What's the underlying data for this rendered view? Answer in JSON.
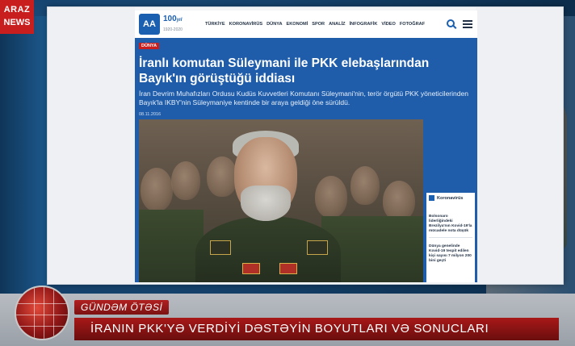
{
  "channel": {
    "line1": "ARAZ",
    "line2": "NEWS"
  },
  "site": {
    "logo_text": "AA",
    "anniversary": "100",
    "anniversary_suffix": "yıl",
    "anniversary_sub": "1920-2020",
    "nav": [
      "TÜRKİYE",
      "KORONAVİRÜS",
      "DÜNYA",
      "EKONOMİ",
      "SPOR",
      "ANALİZ",
      "İNFOGRAFİK",
      "VİDEO",
      "FOTOĞRAF"
    ]
  },
  "article": {
    "category": "DÜNYA",
    "headline": "İranlı komutan Süleymani ile PKK elebaşlarından Bayık'ın görüştüğü iddiası",
    "lede": "İran Devrim Muhafızları Ordusu Kudüs Kuvvetleri Komutanı Süleymani'nin, terör örgütü PKK yöneticilerinden Bayık'la IKBY'nin Süleymaniye kentinde bir araya geldiği öne sürüldü.",
    "date": "08.11.2016"
  },
  "sidebar": {
    "title": "Koronavirüs",
    "items": [
      "Bolsonaro liderliğindeki Brezilya'nın Kovid-19'la mücadele nota düşük",
      "Dünya genelinde Kovid-19 tespit edilen kişi sayısı 7 milyon 200 bini geçti"
    ]
  },
  "ticker": {
    "label": "GÜNDƏM ÖTƏSİ",
    "headline": "İRANIN PKK'YƏ VERDİYİ DƏSTƏYİN  BOYUTLARI VƏ SONUCLARI"
  },
  "colors": {
    "brand_red": "#c81e1e",
    "site_blue": "#1f5dab"
  }
}
